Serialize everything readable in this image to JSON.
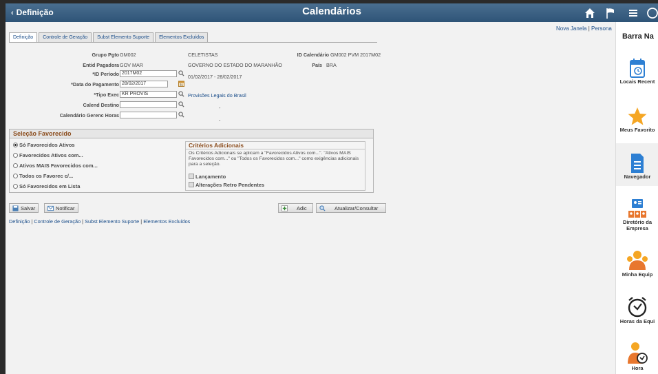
{
  "header": {
    "back_label": "Definição",
    "title": "Calendários"
  },
  "toplinks": {
    "new_window": "Nova Janela",
    "separator": "|",
    "personalize": "Persona"
  },
  "tabs": [
    {
      "label": "Definição",
      "active": true
    },
    {
      "label": "Controle de Geração",
      "active": false
    },
    {
      "label": "Subst Elemento Suporte",
      "active": false
    },
    {
      "label": "Elementos Excluídos",
      "active": false
    }
  ],
  "form": {
    "grupo_pgto_label": "Grupo Pgto",
    "grupo_pgto_value": "GM002",
    "grupo_pgto_desc": "CELETISTAS",
    "id_calendario_label": "ID Calendário",
    "id_calendario_value": "GM002 PVM 2017M02",
    "entid_pagadora_label": "Entid Pagadora",
    "entid_pagadora_value": "GOV MAR",
    "entid_pagadora_desc": "GOVERNO DO ESTADO DO MARANHÃO",
    "pais_label": "País",
    "pais_value": "BRA",
    "id_periodo_label": "*ID Período",
    "id_periodo_value": "2017M02",
    "periodo_range": "01/02/2017  -  28/02/2017",
    "data_pagamento_label": "*Data do Pagamento",
    "data_pagamento_value": "28/02/2017",
    "tipo_exec_label": "*Tipo Exec",
    "tipo_exec_value": "KR PROVIS",
    "tipo_exec_desc": "Provisões Legais do Brasil",
    "calend_destino_label": "Calend Destino",
    "calend_destino_value": "",
    "calend_destino_desc": "-",
    "calendario_gerenc_label": "Calendário Gerenc Horas",
    "calendario_gerenc_value": "",
    "calendario_gerenc_desc": "-"
  },
  "selecao": {
    "title": "Seleção Favorecido",
    "options": [
      {
        "label": "Só Favorecidos Ativos",
        "selected": true
      },
      {
        "label": "Favorecidos Ativos com...",
        "selected": false
      },
      {
        "label": "Ativos MAIS Favorecidos com...",
        "selected": false
      },
      {
        "label": "Todos os Favorec c/...",
        "selected": false
      },
      {
        "label": "Só Favorecidos em Lista",
        "selected": false
      }
    ],
    "criterios": {
      "title": "Critérios Adicionais",
      "description": "Os Critérios Adicionais se aplicam a \"Favorecidos Ativos com...\". \"Ativos MAIS Favorecidos com...\" ou \"Todos os Favorecidos com...\" como exigências adicionais para a seleção.",
      "checkboxes": [
        {
          "label": "Lançamento",
          "checked": false
        },
        {
          "label": "Alterações Retro Pendentes",
          "checked": false
        }
      ]
    }
  },
  "buttons": {
    "save": "Salvar",
    "notify": "Notificar",
    "add": "Adic",
    "update": "Atualizar/Consultar"
  },
  "bottom_links": [
    "Definição",
    "Controle de Geração",
    "Subst Elemento Suporte",
    "Elementos Excluídos"
  ],
  "bottom_links_separator": "|",
  "sidebar": {
    "title": "Barra Na",
    "items": [
      {
        "label": "Locais Recent",
        "icon": "calendar-clock-icon"
      },
      {
        "label": "Meus Favorito",
        "icon": "star-icon"
      },
      {
        "label": "Navegador",
        "icon": "document-icon",
        "selected": true
      },
      {
        "label": "Diretório da",
        "label2": "Empresa",
        "icon": "directory-icon"
      },
      {
        "label": "Minha Equip",
        "icon": "team-icon"
      },
      {
        "label": "Horas da Equi",
        "icon": "alarm-clock-icon"
      },
      {
        "label": "Hora",
        "icon": "person-clock-icon"
      }
    ]
  },
  "colors": {
    "header_bg": "#3a6285",
    "link": "#1b4e8a",
    "section_title": "#8a4b1b",
    "star": "#f5a623",
    "nav_blue": "#2d7fd3"
  }
}
